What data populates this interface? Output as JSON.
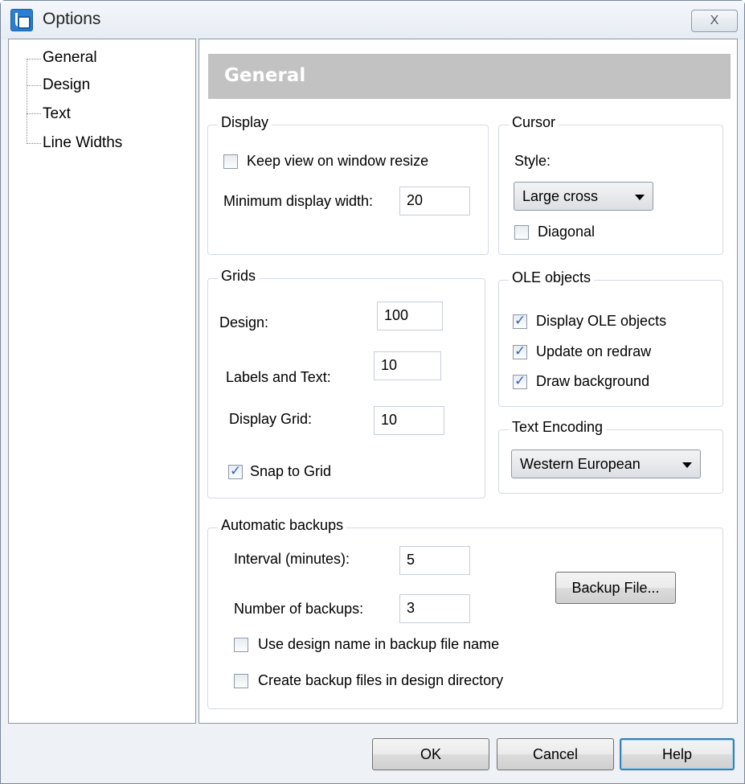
{
  "window": {
    "title": "Options",
    "close_glyph": "X"
  },
  "tree": {
    "items": [
      "General",
      "Design",
      "Text",
      "Line Widths"
    ]
  },
  "panel": {
    "heading": "General"
  },
  "display_group": {
    "legend": "Display",
    "keep_view_label": "Keep view on window resize",
    "keep_view_checked": false,
    "min_width_label": "Minimum display width:",
    "min_width_value": "20"
  },
  "cursor_group": {
    "legend": "Cursor",
    "style_label": "Style:",
    "style_value": "Large cross",
    "diagonal_label": "Diagonal",
    "diagonal_checked": false
  },
  "grids_group": {
    "legend": "Grids",
    "design_label": "Design:",
    "design_value": "100",
    "labels_label": "Labels and Text:",
    "labels_value": "10",
    "display_grid_label": "Display Grid:",
    "display_grid_value": "10",
    "snap_label": "Snap to Grid",
    "snap_checked": true
  },
  "ole_group": {
    "legend": "OLE objects",
    "display_label": "Display OLE objects",
    "update_label": "Update on redraw",
    "background_label": "Draw background"
  },
  "encoding_group": {
    "legend": "Text Encoding",
    "value": "Western European"
  },
  "backup_group": {
    "legend": "Automatic backups",
    "interval_label": "Interval (minutes):",
    "interval_value": "5",
    "number_label": "Number of backups:",
    "number_value": "3",
    "backup_file_button": "Backup File...",
    "use_name_label": "Use design name in backup file name",
    "create_dir_label": "Create backup files in design directory"
  },
  "footer": {
    "ok": "OK",
    "cancel": "Cancel",
    "help": "Help"
  }
}
